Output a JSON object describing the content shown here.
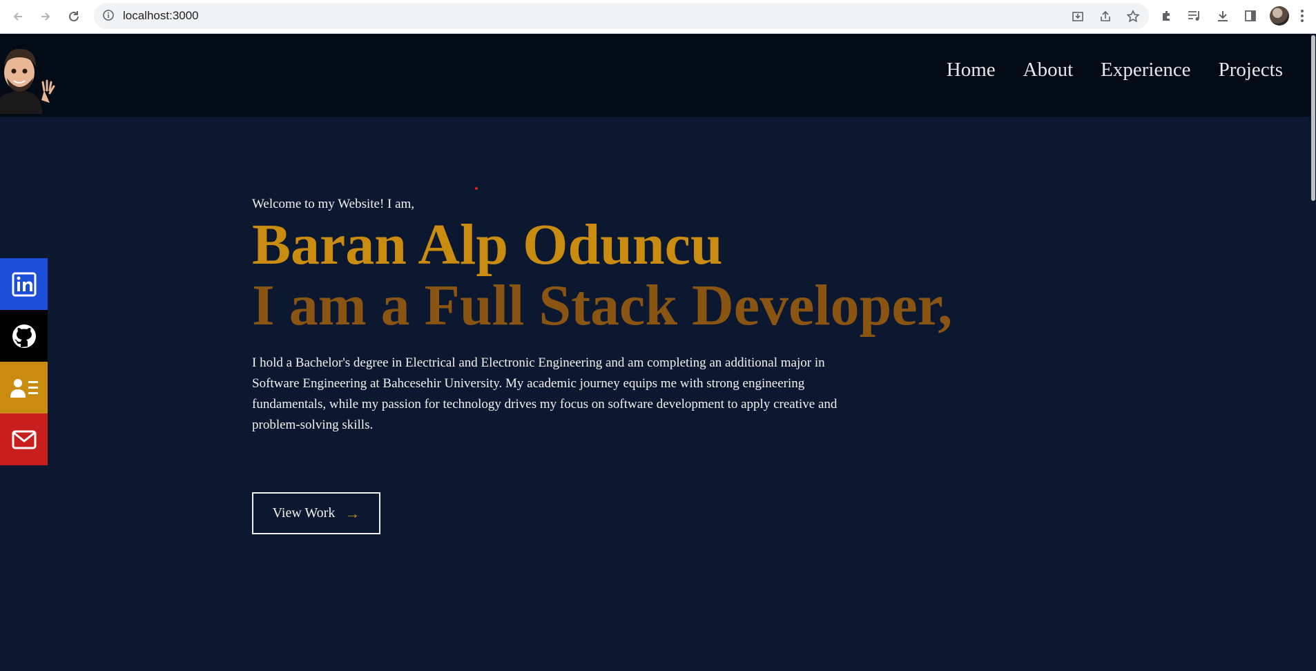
{
  "browser": {
    "url": "localhost:3000",
    "icons": [
      "back-icon",
      "forward-icon",
      "reload-icon",
      "info-icon",
      "install-icon",
      "share-icon",
      "star-icon",
      "extensions-icon",
      "media-icon",
      "download-icon",
      "side-panel-icon",
      "profile-avatar",
      "menu-kebab-icon"
    ]
  },
  "navbar": {
    "links": [
      "Home",
      "About",
      "Experience",
      "Projects"
    ]
  },
  "hero": {
    "welcome": "Welcome to my Website! I am,",
    "name": "Baran Alp Oduncu",
    "role": "I am a Full Stack Developer,",
    "bio": "I hold a Bachelor's degree in Electrical and Electronic Engineering and am completing an additional major in Software Engineering at Bahcesehir University. My academic journey equips me with strong engineering fundamentals, while my passion for technology drives my focus on software development to apply creative and problem-solving skills.",
    "button_label": "View Work"
  },
  "social": [
    {
      "name": "linkedin",
      "icon": "linkedin-icon",
      "color": "#1d4ed8"
    },
    {
      "name": "github",
      "icon": "github-icon",
      "color": "#000000"
    },
    {
      "name": "resume",
      "icon": "resume-icon",
      "color": "#c98c10"
    },
    {
      "name": "mail",
      "icon": "mail-icon",
      "color": "#c81e1e"
    }
  ],
  "colors": {
    "background": "#0b1830",
    "navbar": "#030b16",
    "accent": "#c98c10",
    "role_text": "#8a5413",
    "text": "#f2f2f2"
  }
}
